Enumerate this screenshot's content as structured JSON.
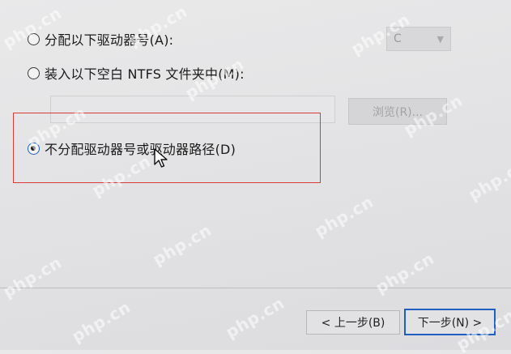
{
  "options": {
    "assign_letter": "分配以下驱动器号(A):",
    "mount_folder": "装入以下空白 NTFS 文件夹中(M):",
    "no_letter": "不分配驱动器号或驱动器路径(D)",
    "selected": "no_letter"
  },
  "drive_letter": {
    "value": "C"
  },
  "browse_label": "浏览(R)...",
  "buttons": {
    "back": "< 上一步(B)",
    "next": "下一步(N) >"
  },
  "watermark": "php.cn",
  "colors": {
    "highlight": "#d83a3a",
    "focus": "#1f5fbf"
  }
}
